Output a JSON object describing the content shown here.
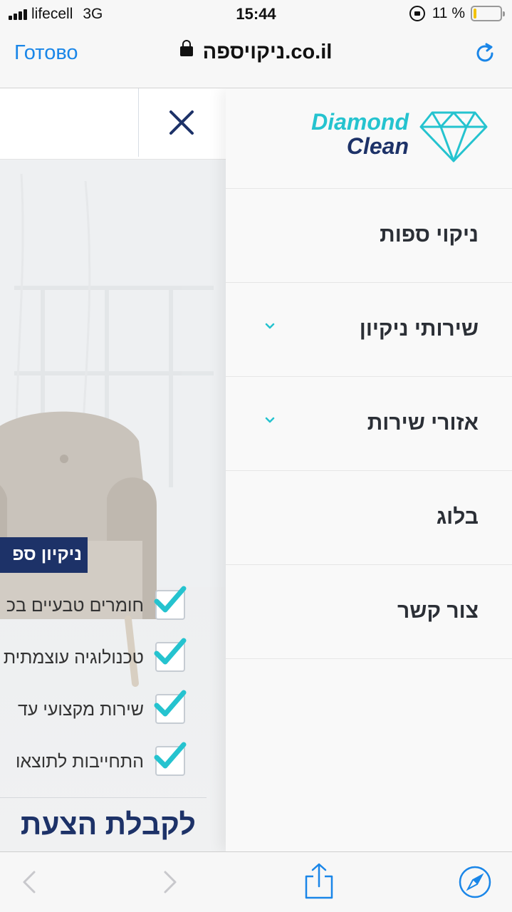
{
  "status_bar": {
    "carrier": "lifecell",
    "network": "3G",
    "time": "15:44",
    "battery": "11 %",
    "battery_level": 0.11
  },
  "browser": {
    "done_label": "Готово",
    "url": "ניקויספה.co.il"
  },
  "page": {
    "hero_tag": "ניקיון ספ",
    "features": [
      {
        "text": "חומרים טבעיים בכ"
      },
      {
        "text": "טכנולוגיה עוצמתית"
      },
      {
        "text": "שירות מקצועי עד"
      },
      {
        "text": "התחייבות לתוצאו"
      }
    ],
    "cta": "לקבלת הצעת"
  },
  "menu": {
    "logo_line1": "Diamond",
    "logo_line2": "Clean",
    "items": [
      {
        "label": "ניקוי ספות",
        "has_submenu": false
      },
      {
        "label": "שירותי ניקיון",
        "has_submenu": true
      },
      {
        "label": "אזורי שירות",
        "has_submenu": true
      },
      {
        "label": "בלוג",
        "has_submenu": false
      },
      {
        "label": "צור קשר",
        "has_submenu": false
      }
    ]
  },
  "colors": {
    "brand_navy": "#1d3268",
    "brand_cyan": "#25c3cf",
    "ios_blue": "#1a86e8"
  },
  "icons": {
    "close": "close-icon",
    "check": "checkbox-checked-icon",
    "chevron": "chevron-down-icon",
    "back": "back-arrow-icon",
    "forward": "forward-arrow-icon",
    "share": "share-icon",
    "safari": "compass-icon",
    "reload": "reload-icon",
    "lock": "padlock-icon"
  }
}
